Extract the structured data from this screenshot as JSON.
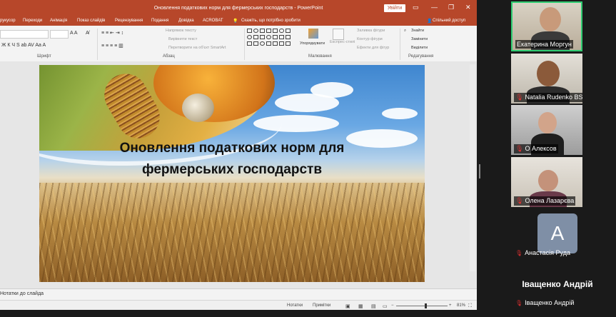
{
  "window": {
    "title": "Оновлення податкових норм для фермерських господарств - PowerPoint",
    "signin_label": "Увійти",
    "minimize_glyph": "—",
    "restore_glyph": "❐",
    "close_glyph": "✕",
    "ribbon_toggle_glyph": "▭"
  },
  "menu": {
    "items": [
      "рукусор",
      "Переходи",
      "Анімація",
      "Показ слайдів",
      "Рецензування",
      "Подання",
      "Довідка",
      "ACROBAT"
    ],
    "search_text": "Скажіть, що потрібно зробити",
    "share_label": "Спільний доступ"
  },
  "ribbon": {
    "font_group_label": "Шрифт",
    "paragraph_group_label": "Абзац",
    "drawing_group_label": "Малювання",
    "editing_group_label": "Редагування",
    "text_direction": "Напрямок тексту",
    "align_text": "Вирівняти текст",
    "smartart": "Перетворити на об'єкт SmartArt",
    "arrange_label": "Упорядкувати",
    "quick_styles_label": "Експрес-стилі",
    "shape_fill": "Заливка фігури",
    "shape_outline": "Контур фігури",
    "shape_effects": "Ефекти для фігур",
    "find_label": "Знайти",
    "replace_label": "Замінити",
    "select_label": "Виділити"
  },
  "slide": {
    "title_line1": "Оновлення податкових норм для",
    "title_line2": "фермерських господарств"
  },
  "notes": {
    "label": "Нотатки до слайда"
  },
  "status": {
    "notes_btn": "Нотатки",
    "comments_btn": "Примітки",
    "zoom_level": "81%"
  },
  "participants": [
    {
      "name": "Екатерина Моргун",
      "muted": false,
      "active": true
    },
    {
      "name": "Natalia Rudenko BSNU",
      "muted": true,
      "active": false
    },
    {
      "name": "O Алексов",
      "muted": true,
      "active": false
    },
    {
      "name": "Олена Лазарєва",
      "muted": true,
      "active": false
    },
    {
      "name": "Анастасія Руда",
      "muted": true,
      "active": false,
      "avatar_letter": "A"
    },
    {
      "name": "Іващенко Андрій",
      "muted": true,
      "active": false
    }
  ],
  "big_name": "Іващенко Андрій"
}
